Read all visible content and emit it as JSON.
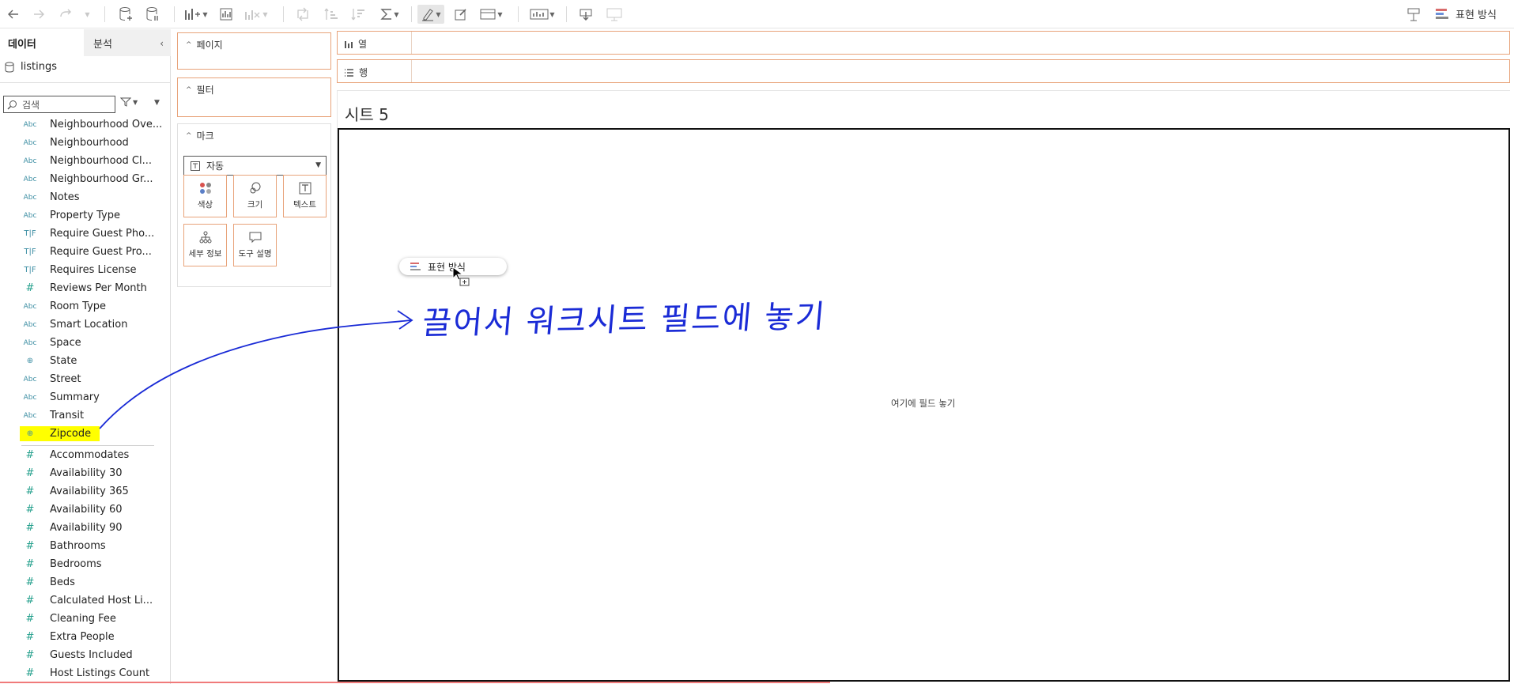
{
  "toolbar": {
    "show_me_label": "표현 방식"
  },
  "data_pane": {
    "tab_data": "데이터",
    "tab_analysis": "분석",
    "collapse_icon": "‹",
    "datasource": "listings",
    "search_placeholder": "검색",
    "fields_dimensions": [
      {
        "type": "abc",
        "label": "Neighbourhood Ove..."
      },
      {
        "type": "abc",
        "label": "Neighbourhood"
      },
      {
        "type": "abc",
        "label": "Neighbourhood Cl..."
      },
      {
        "type": "abc",
        "label": "Neighbourhood Gr..."
      },
      {
        "type": "abc",
        "label": "Notes"
      },
      {
        "type": "abc",
        "label": "Property Type"
      },
      {
        "type": "tf",
        "label": "Require Guest Pho..."
      },
      {
        "type": "tf",
        "label": "Require Guest Pro..."
      },
      {
        "type": "tf",
        "label": "Requires License"
      },
      {
        "type": "num",
        "label": "Reviews Per Month"
      },
      {
        "type": "abc",
        "label": "Room Type"
      },
      {
        "type": "abc",
        "label": "Smart Location"
      },
      {
        "type": "abc",
        "label": "Space"
      },
      {
        "type": "geo",
        "label": "State"
      },
      {
        "type": "abc",
        "label": "Street"
      },
      {
        "type": "abc",
        "label": "Summary"
      },
      {
        "type": "abc",
        "label": "Transit"
      },
      {
        "type": "geo",
        "label": "Zipcode",
        "highlighted": true
      }
    ],
    "fields_measures": [
      {
        "type": "num",
        "label": "Accommodates"
      },
      {
        "type": "num",
        "label": "Availability 30"
      },
      {
        "type": "num",
        "label": "Availability 365"
      },
      {
        "type": "num",
        "label": "Availability 60"
      },
      {
        "type": "num",
        "label": "Availability 90"
      },
      {
        "type": "num",
        "label": "Bathrooms"
      },
      {
        "type": "num",
        "label": "Bedrooms"
      },
      {
        "type": "num",
        "label": "Beds"
      },
      {
        "type": "num",
        "label": "Calculated Host Li..."
      },
      {
        "type": "num",
        "label": "Cleaning Fee"
      },
      {
        "type": "num",
        "label": "Extra People"
      },
      {
        "type": "num",
        "label": "Guests Included"
      },
      {
        "type": "num",
        "label": "Host Listings Count"
      }
    ],
    "type_glyphs": {
      "abc": "Abc",
      "tf": "T|F",
      "num": "#",
      "geo": "⊕"
    }
  },
  "cards": {
    "pages": "페이지",
    "filters": "필터",
    "marks": "마크",
    "mark_type": "자동",
    "buttons": {
      "color": "색상",
      "size": "크기",
      "text": "텍스트",
      "detail": "세부 정보",
      "tooltip": "도구 설명"
    }
  },
  "shelves": {
    "columns": "열",
    "rows": "행"
  },
  "sheet": {
    "title": "시트 5",
    "drop_hint": "여기에 필드 놓기",
    "drag_pill": "표현 방식"
  },
  "annotation": "끌어서 워크시트 필드에 놓기",
  "colors": {
    "accent_border": "#e8a37a",
    "highlight": "#ffff00",
    "annotation": "#1a2bd6"
  }
}
